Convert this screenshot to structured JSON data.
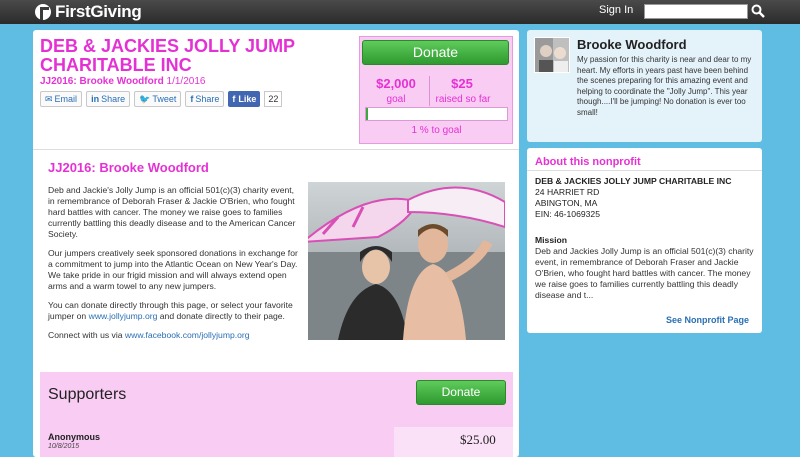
{
  "header": {
    "logo_text": "FirstGiving",
    "signin_label": "Sign In",
    "search_placeholder": ""
  },
  "campaign": {
    "title": "DEB & JACKIES JOLLY JUMP CHARITABLE INC",
    "subtitle_name": "JJ2016: Brooke Woodford",
    "subtitle_date": "1/1/2016",
    "share": {
      "email": "Email",
      "linkedin": "Share",
      "twitter": "Tweet",
      "facebook": "Share",
      "like": "Like",
      "like_count": "22"
    }
  },
  "donate_panel": {
    "donate_label": "Donate",
    "goal_value": "$2,000",
    "goal_label": "goal",
    "raised_value": "$25",
    "raised_label": "raised so far",
    "progress_percent": 1,
    "percent_text": "1 % to goal"
  },
  "story": {
    "title": "JJ2016: Brooke Woodford",
    "p1": "Deb and Jackie's Jolly Jump is an official 501(c)(3) charity event, in remembrance of Deborah Fraser & Jackie O'Brien, who fought hard battles with cancer. The money we raise goes to families currently battling this deadly disease and to the American Cancer Society.",
    "p2": "Our jumpers creatively seek sponsored donations in exchange for a commitment to jump into the Atlantic Ocean on New Year's Day. We take pride in our frigid mission and will always extend open arms and a warm towel to any new jumpers.",
    "p3_a": "You can donate directly through this page, or select your favorite jumper on ",
    "p3_link": "www.jollyjump.org",
    "p3_b": " and donate directly to their page.",
    "p4_a": "Connect with us via ",
    "p4_link": "www.facebook.com/jollyjump.org"
  },
  "supporters": {
    "title": "Supporters",
    "donate_label": "Donate",
    "rows": [
      {
        "name": "Anonymous",
        "date": "10/8/2015",
        "amount": "$25.00"
      }
    ]
  },
  "profile": {
    "name": "Brooke Woodford",
    "text": "My passion for this charity is near and dear to my heart. My efforts in years past have been behind the scenes preparing for this amazing event and helping to coordinate the \"Jolly Jump\". This year though....I'll be jumping! No donation is ever too small!"
  },
  "nonprofit": {
    "title": "About this nonprofit",
    "name": "DEB & JACKIES JOLLY JUMP CHARITABLE INC",
    "address1": "24 HARRIET RD",
    "address2": "ABINGTON, MA",
    "ein": "EIN: 46-1069325",
    "mission_label": "Mission",
    "mission_text": "Deb and Jackies Jolly Jump is an official 501(c)(3) charity event, in remembrance of Deborah Fraser and Jackie O'Brien, who fought hard battles with cancer. The money we raise goes to families currently battling this deadly disease and t...",
    "link_label": "See Nonprofit Page"
  },
  "colors": {
    "accent": "#e531d4",
    "background": "#5fbde3",
    "panel_pink": "#f9ccf3",
    "button_green": "#3da83d",
    "link_blue": "#2a6fb4"
  }
}
